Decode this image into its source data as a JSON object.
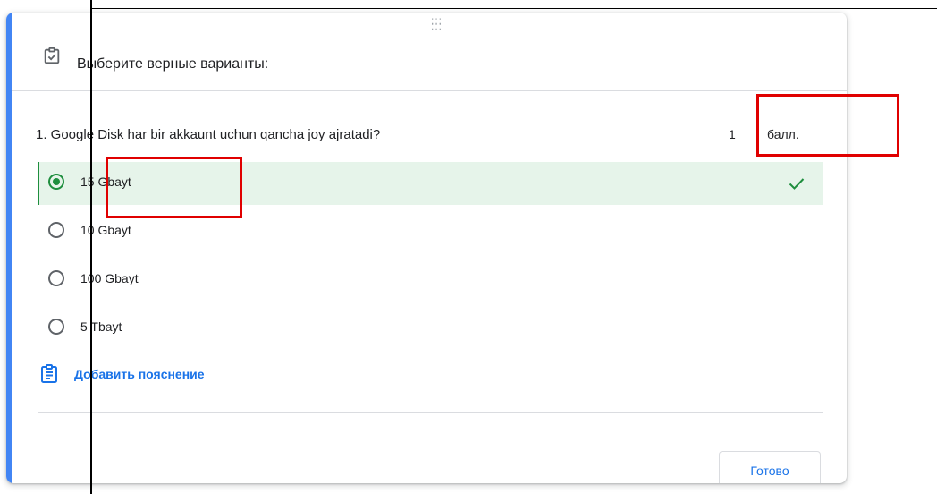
{
  "header": {
    "title": "Выберите верные варианты:",
    "icon": "checkbox-icon"
  },
  "question": {
    "text": "1. Google Disk har bir akkaunt uchun qancha joy ajratadi?",
    "points_value": "1",
    "points_unit": "балл."
  },
  "options": [
    {
      "label": "15 Gbayt",
      "selected": true,
      "correct": true
    },
    {
      "label": "10 Gbayt",
      "selected": false
    },
    {
      "label": "100 Gbayt",
      "selected": false
    },
    {
      "label": "5 Tbayt",
      "selected": false
    }
  ],
  "feedback": {
    "label": "Добавить пояснение",
    "icon": "assignment-icon"
  },
  "footer": {
    "done_label": "Готово"
  },
  "colors": {
    "accent": "#4285f4",
    "correct": "#1e8e3e",
    "correct_bg": "#e6f4ea",
    "link": "#1a73e8",
    "annotation": "#e00000"
  }
}
